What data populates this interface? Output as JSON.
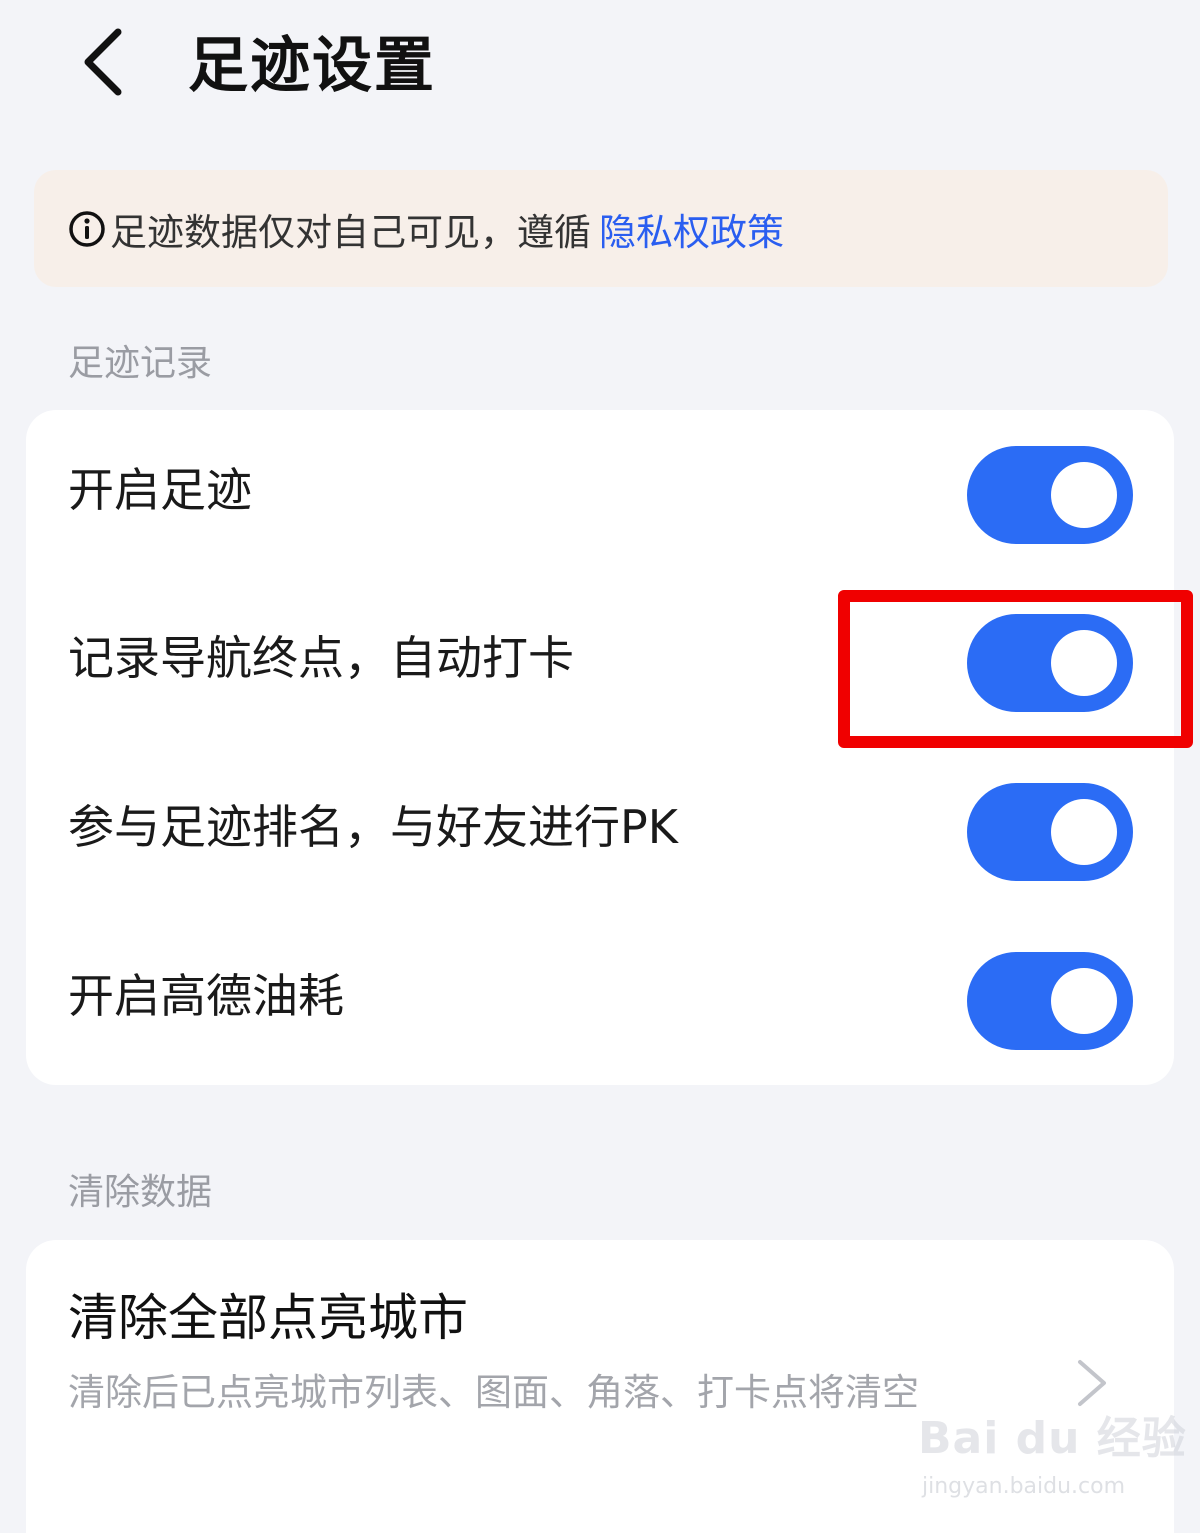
{
  "header": {
    "title": "足迹设置",
    "back_icon": "chevron-left-icon"
  },
  "notice": {
    "icon": "info-circle-icon",
    "text": "足迹数据仅对自己可见，遵循",
    "link": "隐私权政策"
  },
  "section_record": {
    "label": "足迹记录",
    "items": [
      {
        "label": "开启足迹",
        "on": true
      },
      {
        "label": "记录导航终点，自动打卡",
        "on": true
      },
      {
        "label": "参与足迹排名，与好友进行PK",
        "on": true
      },
      {
        "label": "开启高德油耗",
        "on": true
      }
    ]
  },
  "section_clear": {
    "label": "清除数据",
    "item": {
      "title": "清除全部点亮城市",
      "desc": "清除后已点亮城市列表、图面、角落、打卡点将清空",
      "icon": "chevron-right-icon"
    }
  },
  "colors": {
    "toggle_on": "#2b6cf5",
    "link": "#2a5ef0",
    "highlight": "#f00000",
    "notice_bg": "#f7efe9"
  },
  "watermark": {
    "brand": "Bai du 经验",
    "url": "jingyan.baidu.com"
  }
}
